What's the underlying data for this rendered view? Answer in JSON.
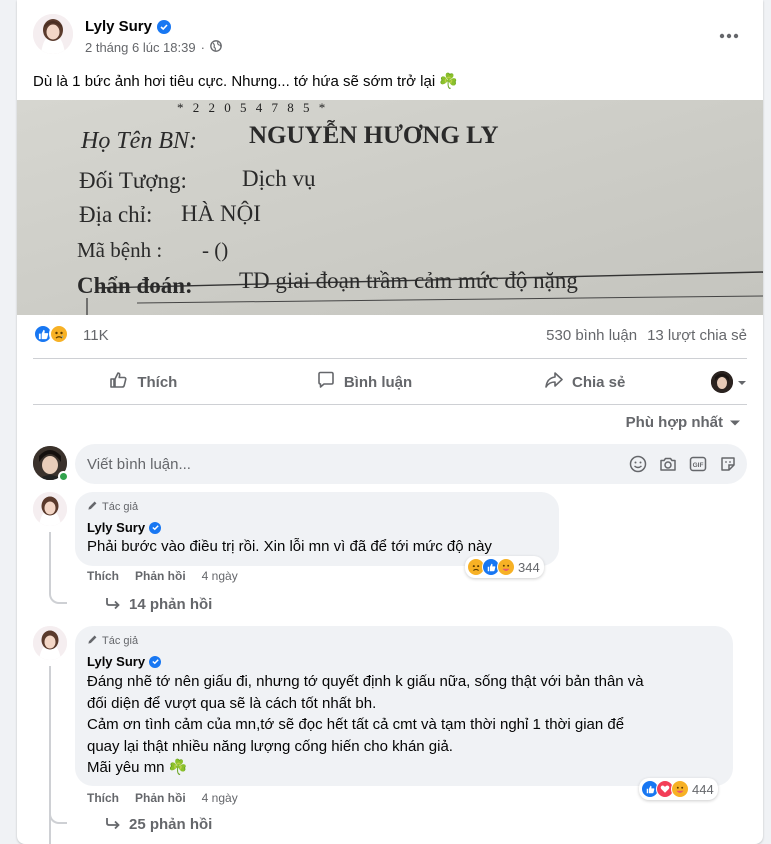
{
  "post": {
    "author": "Lyly Sury",
    "timestamp": "2 tháng 6 lúc 18:39",
    "privacy_icon": "globe-icon",
    "text": "Dù là 1 bức ảnh hơi tiêu cực. Nhưng... tớ hứa sẽ sớm trở lại ☘️",
    "photo": {
      "code": "* 2 2 0 5 4 7 8 5 *",
      "lines": [
        {
          "label": "Họ Tên BN:",
          "value": "NGUYỄN HƯƠNG LY"
        },
        {
          "label": "Đối Tượng:",
          "value": "Dịch vụ"
        },
        {
          "label": "Địa chỉ:",
          "value": "HÀ NỘI"
        },
        {
          "label": "Mã bệnh :",
          "value": "- ()"
        },
        {
          "label": "Chẩn đoán:",
          "value": "TD giai đoạn trầm cảm mức độ nặng"
        }
      ]
    }
  },
  "stats": {
    "reaction_count": "11K",
    "comments": "530 bình luận",
    "shares": "13 lượt chia sẻ",
    "reaction_icons": [
      "like-icon",
      "sad-icon"
    ]
  },
  "actions": {
    "like": "Thích",
    "comment": "Bình luận",
    "share": "Chia sẻ"
  },
  "sort_label": "Phù hợp nhất",
  "comment_input": {
    "placeholder": "Viết bình luận..."
  },
  "comments": [
    {
      "tag": "Tác giả",
      "author": "Lyly Sury",
      "text": "Phải bước vào điều trị rồi. Xin lỗi mn vì đã để tới mức độ này",
      "reaction_count": "344",
      "like": "Thích",
      "reply": "Phản hồi",
      "time": "4 ngày",
      "replies": "14 phản hồi"
    },
    {
      "tag": "Tác giả",
      "author": "Lyly Sury",
      "text": "Đáng nhẽ tớ nên giấu đi, nhưng tớ quyết định k giấu nữa, sống thật với bản thân và\nđối diện để vượt qua sẽ là cách tốt nhất bh.\nCảm ơn tình cảm của mn,tớ sẽ đọc hết tất cả cmt và tạm thời nghỉ 1 thời gian để\nquay lại thật nhiều năng lượng cống hiến cho khán giả.\nMãi yêu mn ☘️",
      "reaction_count": "444",
      "like": "Thích",
      "reply": "Phản hồi",
      "time": "4 ngày",
      "replies": "25 phản hồi"
    }
  ],
  "colors": {
    "facebook_blue": "#1877f2",
    "secondary_text": "#65676b",
    "bubble_bg": "#f0f2f5"
  }
}
